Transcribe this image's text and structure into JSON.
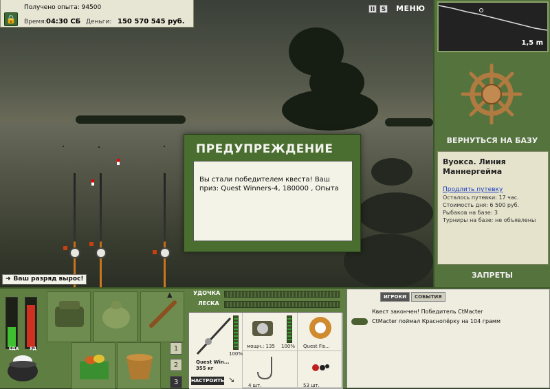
{
  "info": {
    "exp_label": "Получено опыта: 94500",
    "time_label": "Время:",
    "time": "04:30 СБ",
    "money_label": "Деньги:",
    "money": "150 570 545 руб."
  },
  "toolbar": {
    "pause_label": "II",
    "s_label": "S",
    "menu_label": "МЕНЮ"
  },
  "depth": {
    "value_label": "1,5 m"
  },
  "base": {
    "return_label": "ВЕРНУТЬСЯ НА БАЗУ",
    "name": "Вуокса. Линия Маннергейма",
    "permit_link": "Продлить путевку",
    "permit_left": "Осталось путевки: 17 час.",
    "day_cost": "Стоимость дня: 6 500 руб.",
    "fishers": "Рыбаков на базе: 3",
    "tournaments": "Турниры на базе: не объявлены",
    "bans_label": "ЗАПРЕТЫ"
  },
  "dialog": {
    "title": "ПРЕДУПРЕЖДЕНИЕ",
    "message": "Вы стали победителем квеста! Ваш приз: Quest Winners-4, 180000 , Опыта"
  },
  "rank_badge": "Ваш разряд вырос!",
  "meters": {
    "food_label": "ЕДА",
    "poison_label": "ЯД",
    "food_level": 0.4,
    "poison_level": 0.85
  },
  "slots": [
    "1",
    "2",
    "3"
  ],
  "tackle": {
    "rod_label": "УДОЧКА",
    "line_label": "ЛЕСКА",
    "rod_name": "Quest Win...",
    "rod_weight": "355 кг",
    "rod_pct": "100%",
    "reel_label": "мощн.: 135",
    "reel_pct": "100%",
    "line_name": "Quest Fis...",
    "hook_count": "4 шт.",
    "bait_count": "53 шт.",
    "setup_label": "НАСТРОИТЬ"
  },
  "events": {
    "tab_players": "ИГРОКИ",
    "tab_events": "СОБЫТИЯ",
    "items": [
      "Квест закончен! Победитель CtMacter",
      "CtMacter поймал Краснопёрку на 104 грамм"
    ]
  },
  "colors": {
    "panel_green": "#55733d",
    "dialog_green": "#4a6e30",
    "food_meter": "#40c030",
    "poison_meter": "#d03020"
  }
}
